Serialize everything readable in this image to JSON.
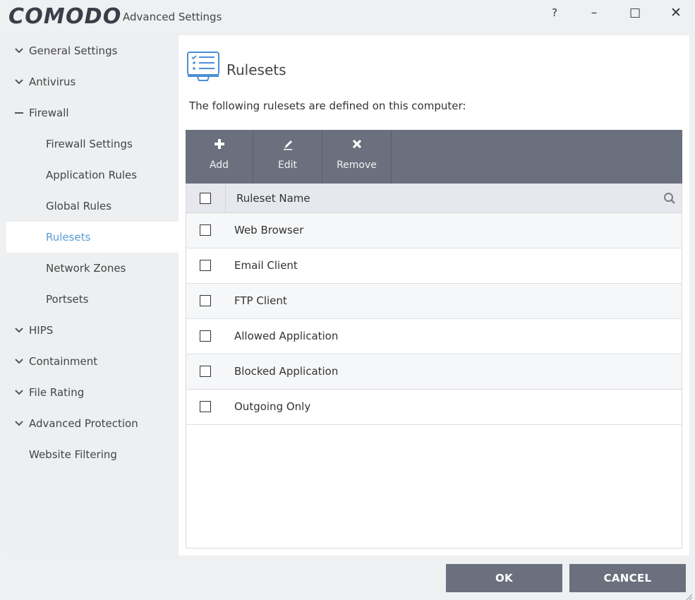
{
  "window": {
    "logo_text": "COMODO",
    "title": "Advanced Settings",
    "help": "?",
    "minimize": "–",
    "maximize": "□",
    "close": "✕"
  },
  "sidebar": {
    "items": [
      {
        "label": "General Settings",
        "icon": "chevron-down-icon",
        "level": 0
      },
      {
        "label": "Antivirus",
        "icon": "chevron-down-icon",
        "level": 0
      },
      {
        "label": "Firewall",
        "icon": "collapse-dash-icon",
        "level": 0
      },
      {
        "label": "Firewall Settings",
        "level": 1
      },
      {
        "label": "Application Rules",
        "level": 1
      },
      {
        "label": "Global Rules",
        "level": 1
      },
      {
        "label": "Rulesets",
        "level": 1,
        "active": true
      },
      {
        "label": "Network Zones",
        "level": 1
      },
      {
        "label": "Portsets",
        "level": 1
      },
      {
        "label": "HIPS",
        "icon": "chevron-down-icon",
        "level": 0
      },
      {
        "label": "Containment",
        "icon": "chevron-down-icon",
        "level": 0
      },
      {
        "label": "File Rating",
        "icon": "chevron-down-icon",
        "level": 0
      },
      {
        "label": "Advanced Protection",
        "icon": "chevron-down-icon",
        "level": 0
      },
      {
        "label": "Website Filtering",
        "level": 0
      }
    ]
  },
  "main": {
    "title": "Rulesets",
    "icon": "ruleset-list-icon",
    "description": "The following rulesets are defined on this computer:",
    "toolbar": {
      "add_label": "Add",
      "edit_label": "Edit",
      "remove_label": "Remove"
    },
    "table": {
      "column_header": "Ruleset Name",
      "rows": [
        {
          "name": "Web Browser",
          "checked": false
        },
        {
          "name": "Email Client",
          "checked": false
        },
        {
          "name": "FTP Client",
          "checked": false
        },
        {
          "name": "Allowed Application",
          "checked": false
        },
        {
          "name": "Blocked Application",
          "checked": false
        },
        {
          "name": "Outgoing Only",
          "checked": false
        }
      ]
    }
  },
  "footer": {
    "ok_label": "OK",
    "cancel_label": "CANCEL"
  },
  "colors": {
    "accent": "#5b9bd5",
    "toolbar_bg": "#6b707e",
    "window_bg": "#eef0f2"
  }
}
